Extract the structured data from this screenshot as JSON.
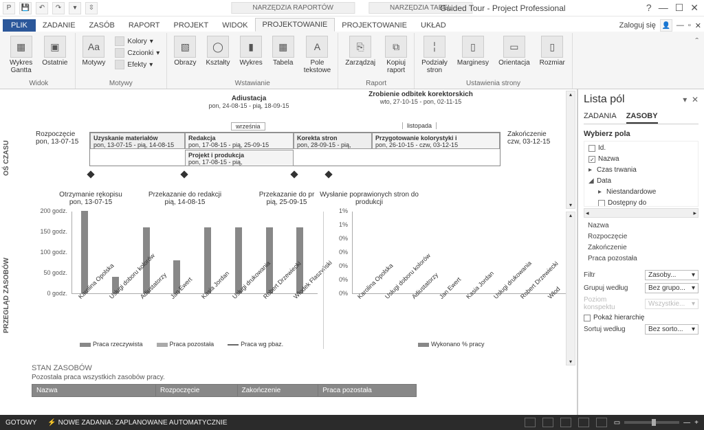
{
  "window": {
    "title": "Guided Tour - Project Professional",
    "contextual_tabs": [
      "NARZĘDZIA RAPORTÓW",
      "NARZĘDZIA TABEL"
    ],
    "login": "Zaloguj się"
  },
  "tabs": {
    "file": "PLIK",
    "items": [
      "ZADANIE",
      "ZASÓB",
      "RAPORT",
      "PROJEKT",
      "WIDOK",
      "PROJEKTOWANIE",
      "PROJEKTOWANIE",
      "UKŁAD"
    ],
    "active_index": 5
  },
  "ribbon": {
    "groups": {
      "widok": {
        "label": "Widok",
        "gantt": "Wykres\nGantta",
        "recent": "Ostatnie"
      },
      "motywy": {
        "label": "Motywy",
        "themes": "Motywy",
        "colors": "Kolory",
        "fonts": "Czcionki",
        "effects": "Efekty"
      },
      "wstawianie": {
        "label": "Wstawianie",
        "images": "Obrazy",
        "shapes": "Kształty",
        "chart": "Wykres",
        "table": "Tabela",
        "textbox": "Pole\ntekstowe"
      },
      "raport": {
        "label": "Raport",
        "manage": "Zarządzaj",
        "copy": "Kopiuj\nraport"
      },
      "page": {
        "label": "Ustawienia strony",
        "breaks": "Podziały\nstron",
        "margins": "Marginesy",
        "orientation": "Orientacja",
        "size": "Rozmiar"
      }
    }
  },
  "timeline": {
    "axis_label": "OŚ CZASU",
    "start_label": "Rozpoczęcie",
    "start_date": "pon, 13-07-15",
    "end_label": "Zakończenie",
    "end_date": "czw, 03-12-15",
    "month1": "września",
    "month2": "listopada",
    "callouts": [
      {
        "title": "Adiustacja",
        "sub": "pon, 24-08-15 - pią, 18-09-15"
      },
      {
        "title": "Zrobienie odbitek korektorskich",
        "sub": "wto, 27-10-15 - pon, 02-11-15"
      }
    ],
    "tasks": [
      {
        "name": "Uzyskanie materiałów",
        "dates": "pon, 13-07-15 - pią, 14-08-15"
      },
      {
        "name": "Redakcja",
        "dates": "pon, 17-08-15 - pią, 25-09-15"
      },
      {
        "name": "Korekta stron",
        "dates": "pon, 28-09-15 - pią,"
      },
      {
        "name": "Przygotowanie kolorystyki i",
        "dates": "pon, 26-10-15 - czw, 03-12-15"
      },
      {
        "name": "Projekt i produkcja",
        "dates": "pon, 17-08-15 - pią,"
      }
    ],
    "milestones": [
      {
        "title": "Otrzymanie rękopisu",
        "date": "pon, 13-07-15"
      },
      {
        "title": "Przekazanie do redakcji",
        "date": "pią, 14-08-15"
      },
      {
        "title": "Przekazanie do pr",
        "date": "pią, 25-09-15"
      },
      {
        "title": "Wysłanie poprawionych stron do produkcji",
        "date": ""
      }
    ]
  },
  "review_label": "PRZEGLĄD ZASOBÓW",
  "chart_data": [
    {
      "type": "bar",
      "categories": [
        "Karolina Opolska",
        "Usługi doboru kolorów",
        "Adiustatorzy",
        "Jan Ewert",
        "Kasia Jordan",
        "Usługi drukowania",
        "Robert Drzewiecki",
        "Włodek Flaszyński"
      ],
      "series": [
        {
          "name": "Praca rzeczywista",
          "values": [
            245,
            40,
            160,
            80,
            160,
            160,
            160,
            160
          ]
        },
        {
          "name": "Praca pozostała",
          "values": [
            0,
            0,
            0,
            0,
            0,
            0,
            0,
            0
          ]
        }
      ],
      "line_series": {
        "name": "Praca wg pbaz.",
        "values": [
          245,
          40,
          160,
          80,
          160,
          160,
          160,
          160
        ]
      },
      "ylabel": "godz.",
      "ylim": [
        0,
        200
      ],
      "yticks": [
        0,
        50,
        100,
        150,
        200
      ],
      "ytick_labels": [
        "0 godz.",
        "50 godz.",
        "100 godz.",
        "150 godz.",
        "200 godz."
      ]
    },
    {
      "type": "bar",
      "categories": [
        "Karolina Opolska",
        "Usługi doboru kolorów",
        "Adiustatorzy",
        "Jan Ewert",
        "Kasia Jordan",
        "Usługi drukowania",
        "Robert Drzewiecki",
        "Włod"
      ],
      "series": [
        {
          "name": "Wykonano % pracy",
          "values": [
            0,
            0,
            0,
            0,
            0,
            0,
            0,
            0
          ]
        }
      ],
      "ylim": [
        0,
        1
      ],
      "yticks": [
        0,
        0,
        0,
        0,
        0,
        1,
        1
      ],
      "ytick_labels": [
        "0%",
        "0%",
        "0%",
        "0%",
        "0%",
        "1%",
        "1%"
      ]
    }
  ],
  "status_section": {
    "title": "STAN ZASOBÓW",
    "subtitle": "Pozostała praca wszystkich zasobów pracy.",
    "columns": [
      "Nazwa",
      "Rozpoczęcie",
      "Zakończenie",
      "Praca pozostała"
    ]
  },
  "side": {
    "title": "Lista pól",
    "tabs": [
      "ZADANIA",
      "ZASOBY"
    ],
    "active_tab": 1,
    "choose_label": "Wybierz pola",
    "tree": [
      {
        "label": "Id.",
        "checked": false,
        "level": 0,
        "type": "check"
      },
      {
        "label": "Nazwa",
        "checked": true,
        "level": 0,
        "type": "check"
      },
      {
        "label": "Czas trwania",
        "level": 0,
        "type": "expand-closed"
      },
      {
        "label": "Data",
        "level": 0,
        "type": "expand-open"
      },
      {
        "label": "Niestandardowe",
        "level": 1,
        "type": "expand-closed"
      },
      {
        "label": "Dostępny do",
        "checked": false,
        "level": 1,
        "type": "check"
      }
    ],
    "list": [
      "Nazwa",
      "Rozpoczęcie",
      "Zakończenie",
      "Praca pozostała"
    ],
    "filter": {
      "label": "Filtr",
      "value": "Zasoby..."
    },
    "group": {
      "label": "Grupuj według",
      "value": "Bez grupo..."
    },
    "outline": {
      "label": "Poziom konspektu",
      "value": "Wszystkie..."
    },
    "hierarchy": "Pokaż hierarchię",
    "sort": {
      "label": "Sortuj według",
      "value": "Bez sorto..."
    }
  },
  "statusbar": {
    "ready": "GOTOWY",
    "newtasks": "NOWE ZADANIA: ZAPLANOWANE AUTOMATYCZNIE"
  }
}
